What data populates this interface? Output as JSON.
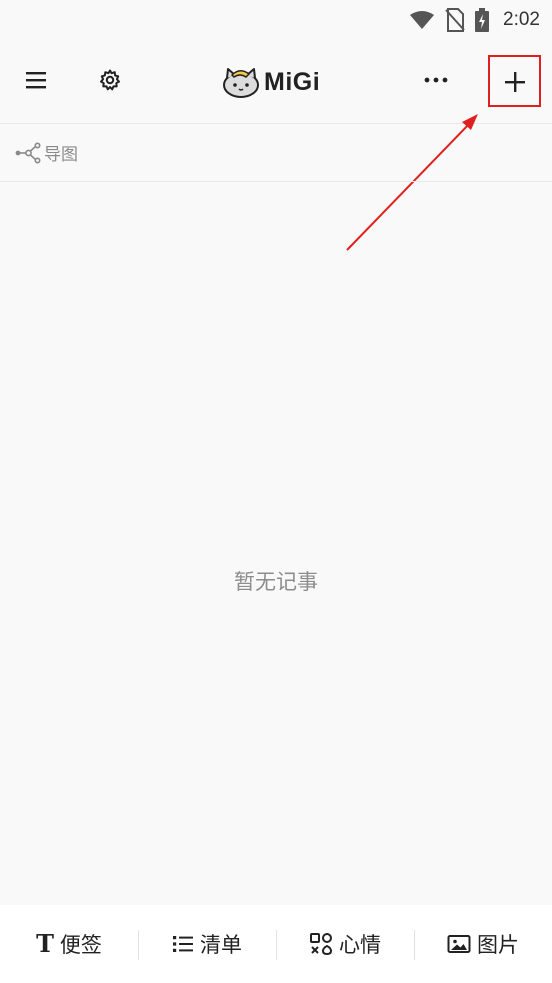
{
  "status_bar": {
    "time": "2:02",
    "icons": [
      "wifi-icon",
      "no-sim-icon",
      "battery-charging-icon"
    ]
  },
  "app_bar": {
    "menu_icon": "menu-icon",
    "settings_icon": "gear-icon",
    "logo_mascot": "cat-mascot-icon",
    "logo_text": "MiGi",
    "more_icon": "more-icon",
    "add_icon": "plus-icon"
  },
  "filter_bar": {
    "mindmap_icon": "mindmap-icon",
    "mindmap_label": "导图"
  },
  "main": {
    "empty_message": "暂无记事"
  },
  "bottom_bar": {
    "items": [
      {
        "label": "便签",
        "icon": "text-icon"
      },
      {
        "label": "清单",
        "icon": "list-icon"
      },
      {
        "label": "心情",
        "icon": "mood-icon"
      },
      {
        "label": "图片",
        "icon": "image-icon"
      }
    ]
  },
  "colors": {
    "background": "#f9f9f9",
    "annotation_red": "#e0201e",
    "muted_text": "#8d8d8d"
  }
}
